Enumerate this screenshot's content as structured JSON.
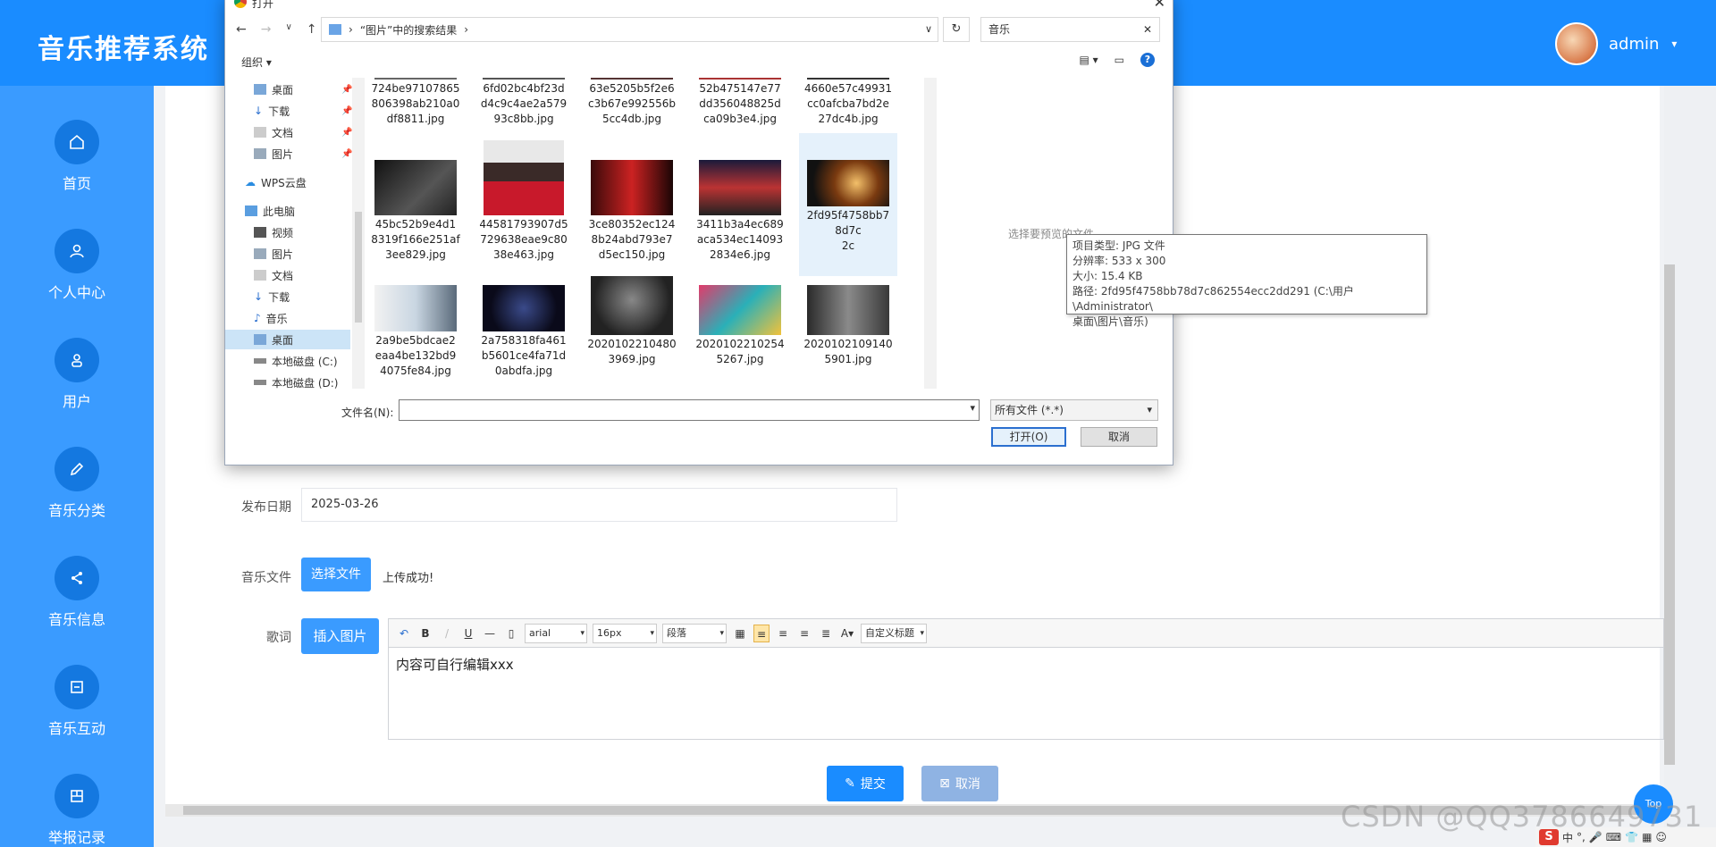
{
  "header": {
    "brand": "音乐推荐系统",
    "user_name": "admin",
    "caret": "▾"
  },
  "sidebar": {
    "items": [
      {
        "label": "首页",
        "icon": "home-icon"
      },
      {
        "label": "个人中心",
        "icon": "user-icon"
      },
      {
        "label": "用户",
        "icon": "person-icon"
      },
      {
        "label": "音乐分类",
        "icon": "edit-icon"
      },
      {
        "label": "音乐信息",
        "icon": "share-icon"
      },
      {
        "label": "音乐互动",
        "icon": "square-minus-icon"
      },
      {
        "label": "举报记录",
        "icon": "grid-icon"
      }
    ]
  },
  "form": {
    "release_date_label": "发布日期",
    "release_date_value": "2025-03-26",
    "music_file_label": "音乐文件",
    "choose_file_btn": "选择文件",
    "upload_status": "上传成功!",
    "lyrics_label": "歌词",
    "insert_image_btn": "插入图片",
    "editor": {
      "font_family": "arial",
      "font_size": "16px",
      "paragraph": "段落",
      "custom_title": "自定义标题",
      "content": "内容可自行编辑xxx"
    },
    "submit_btn": "提交",
    "cancel_btn": "取消"
  },
  "top_button": "Top",
  "watermark": "CSDN @QQ3786649731",
  "tray": {
    "ime": "中"
  },
  "dialog": {
    "title": "打开",
    "close": "✕",
    "breadcrumb": "“图片”中的搜索结果",
    "search_value": "音乐",
    "organize": "组织 ▾",
    "tree": [
      {
        "label": "桌面",
        "pinned": true
      },
      {
        "label": "下载",
        "pinned": true
      },
      {
        "label": "文档",
        "pinned": true
      },
      {
        "label": "图片",
        "pinned": true
      },
      {
        "label": "WPS云盘",
        "pinned": false
      },
      {
        "label": "此电脑",
        "pinned": false
      },
      {
        "label": "视频",
        "pinned": false
      },
      {
        "label": "图片",
        "pinned": false
      },
      {
        "label": "文档",
        "pinned": false
      },
      {
        "label": "下载",
        "pinned": false
      },
      {
        "label": "音乐",
        "pinned": false
      },
      {
        "label": "桌面",
        "pinned": false
      },
      {
        "label": "本地磁盘 (C:)",
        "pinned": false
      },
      {
        "label": "本地磁盘 (D:)",
        "pinned": false
      }
    ],
    "files_row1": [
      [
        "724be97107865",
        "806398ab210a0",
        "df8811.jpg"
      ],
      [
        "6fd02bc4bf23d",
        "d4c9c4ae2a579",
        "93c8bb.jpg"
      ],
      [
        "63e5205b5f2e6",
        "c3b67e992556b",
        "5cc4db.jpg"
      ],
      [
        "52b475147e77",
        "dd356048825d",
        "ca09b3e4.jpg"
      ],
      [
        "4660e57c49931",
        "cc0afcba7bd2e",
        "27dc4b.jpg"
      ]
    ],
    "files_row2": [
      [
        "45bc52b9e4d1",
        "8319f166e251af",
        "3ee829.jpg"
      ],
      [
        "44581793907d5",
        "729638eae9c80",
        "38e463.jpg"
      ],
      [
        "3ce80352ec124",
        "8b24abd793e7",
        "d5ec150.jpg"
      ],
      [
        "3411b3a4ec689",
        "aca534ec14093",
        "2834e6.jpg"
      ],
      [
        "2fd95f4758bb7",
        "8d7c",
        "2c"
      ]
    ],
    "files_row3": [
      [
        "2a9be5bdcae2",
        "eaa4be132bd9",
        "4075fe84.jpg"
      ],
      [
        "2a758318fa461",
        "b5601ce4fa71d",
        "0abdfa.jpg"
      ],
      [
        "2020102210480",
        "3969.jpg",
        ""
      ],
      [
        "2020102210254",
        "5267.jpg",
        ""
      ],
      [
        "2020102109140",
        "5901.jpg",
        ""
      ]
    ],
    "preview_msg": "选择要预览的文件。",
    "tooltip": {
      "type": "项目类型: JPG 文件",
      "resolution": "分辨率: 533 x 300",
      "size": "大小: 15.4 KB",
      "path": "路径: 2fd95f4758bb78d7c862554ecc2dd291 (C:\\用户\\Administrator\\",
      "path2": "桌面\\图片\\音乐)"
    },
    "filename_label": "文件名(N):",
    "filetype": "所有文件 (*.*)",
    "open_btn": "打开(O)",
    "cancel_btn": "取消"
  }
}
